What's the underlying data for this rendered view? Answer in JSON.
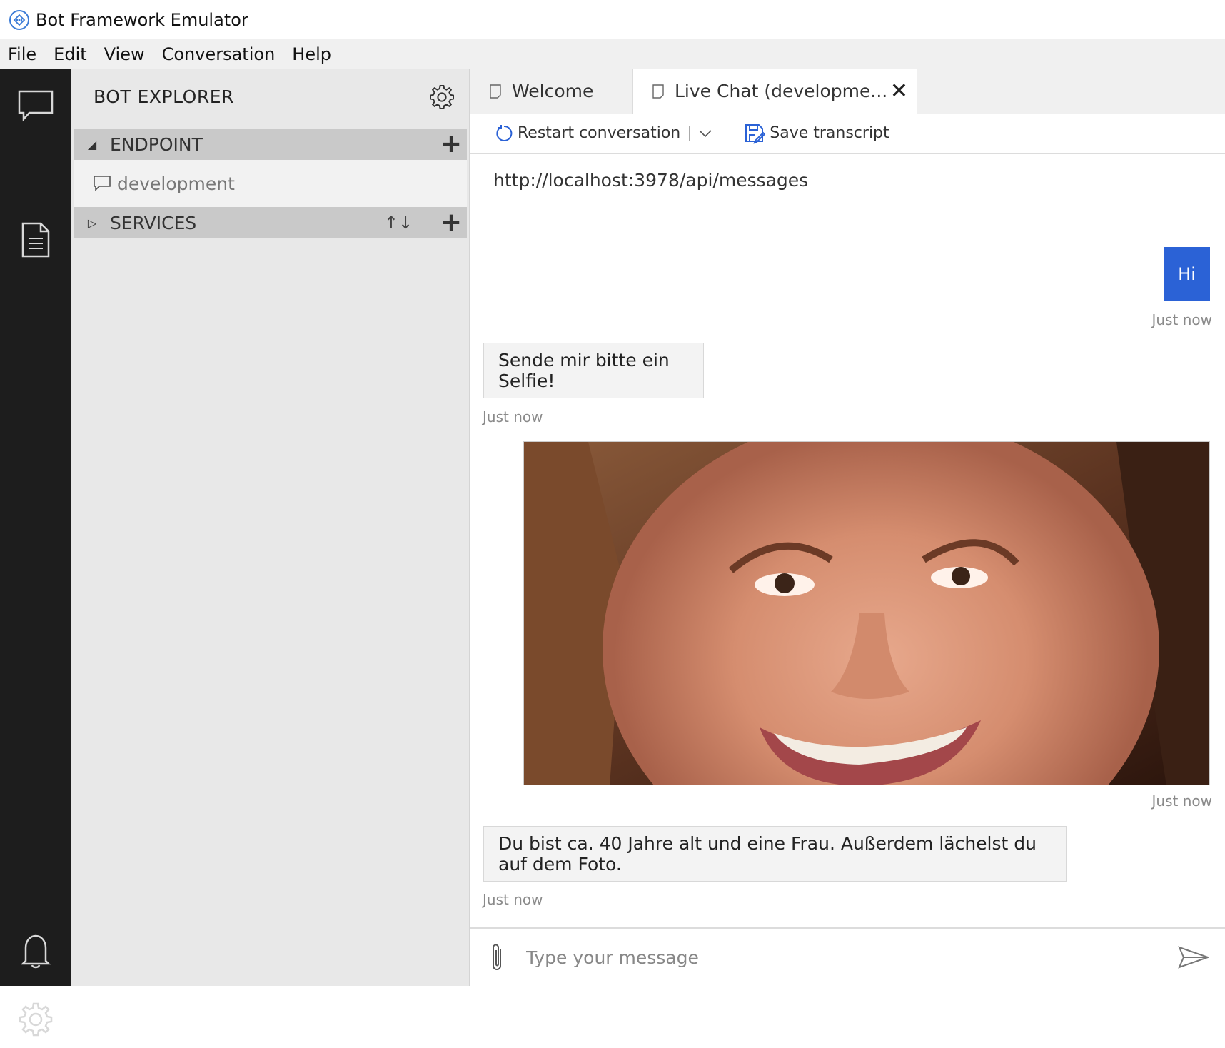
{
  "window": {
    "title": "Bot Framework Emulator"
  },
  "menu": [
    "File",
    "Edit",
    "View",
    "Conversation",
    "Help"
  ],
  "activity_bar": {
    "top": [
      {
        "icon": "chat-icon"
      },
      {
        "icon": "document-icon"
      }
    ],
    "bottom": [
      {
        "icon": "bell-icon"
      },
      {
        "icon": "gear-icon"
      }
    ]
  },
  "explorer": {
    "title": "BOT EXPLORER",
    "settings_icon": "gear-icon",
    "endpoint_section": {
      "label": "ENDPOINT",
      "expanded": true,
      "items": [
        "development"
      ]
    },
    "services_section": {
      "label": "SERVICES",
      "expanded": false,
      "sort_icon": "sort-icon"
    }
  },
  "tabs": [
    {
      "label": "Welcome",
      "active": false
    },
    {
      "label": "Live Chat (developme...",
      "active": true,
      "closable": true
    }
  ],
  "toolbar": {
    "restart_label": "Restart conversation",
    "save_label": "Save transcript"
  },
  "chat": {
    "endpoint_url": "http://localhost:3978/api/messages",
    "messages": [
      {
        "from": "user",
        "text": "Hi",
        "time": "Just now"
      },
      {
        "from": "bot",
        "text": "Sende mir bitte ein Selfie!",
        "time": "Just now"
      },
      {
        "from": "user",
        "type": "image",
        "time": "Just now"
      },
      {
        "from": "bot",
        "text": "Du bist ca. 40 Jahre alt und eine Frau. Außerdem lächelst du auf dem Foto.",
        "time": "Just now"
      }
    ]
  },
  "input": {
    "placeholder": "Type your message"
  },
  "colors": {
    "user_bubble": "#2b62d6",
    "activity_bar": "#1d1d1d",
    "accent": "#2b62d6"
  }
}
